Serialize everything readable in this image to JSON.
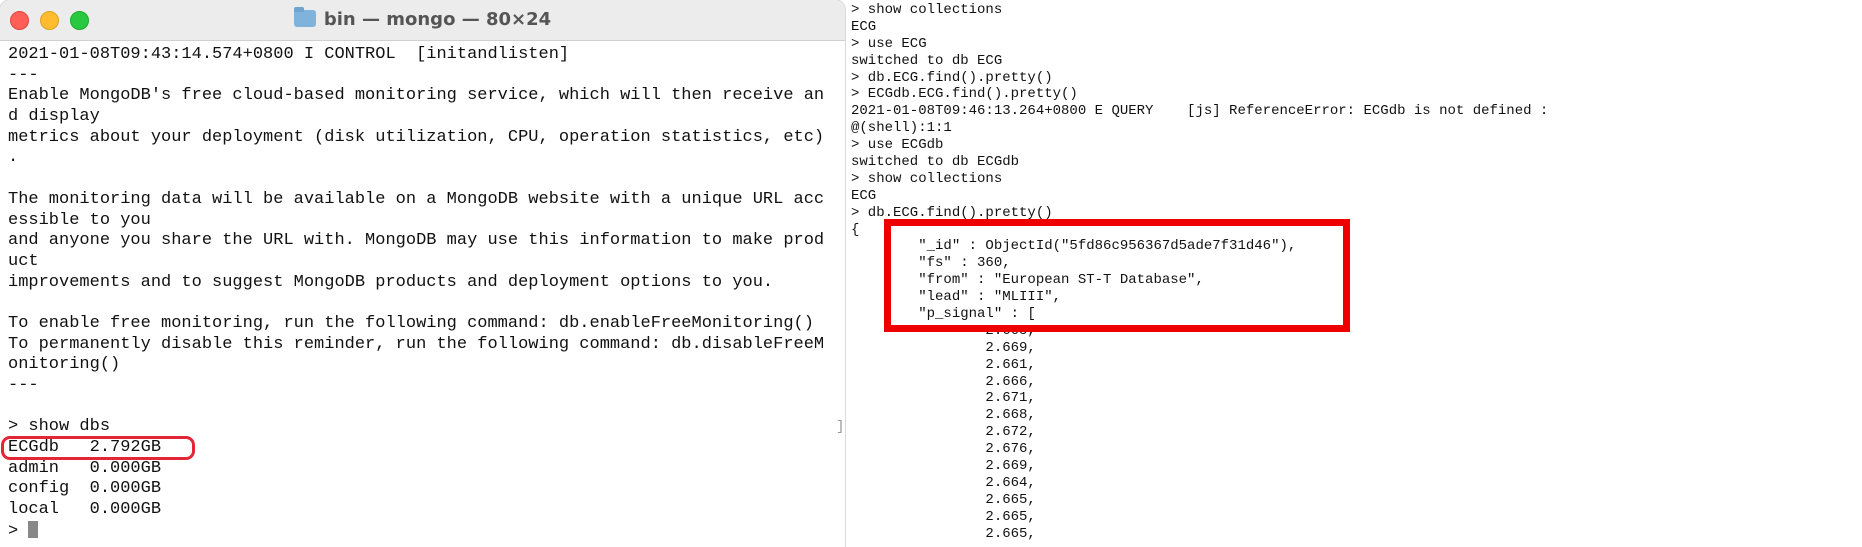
{
  "window": {
    "title": "bin — mongo — 80×24",
    "close_label": "×",
    "minimize_label": "−",
    "zoom_label": "+"
  },
  "left_terminal": {
    "lines": [
      "2021-01-08T09:43:14.574+0800 I CONTROL  [initandlisten]",
      "---",
      "Enable MongoDB's free cloud-based monitoring service, which will then receive an",
      "d display",
      "metrics about your deployment (disk utilization, CPU, operation statistics, etc)",
      ".",
      "",
      "The monitoring data will be available on a MongoDB website with a unique URL acc",
      "essible to you",
      "and anyone you share the URL with. MongoDB may use this information to make prod",
      "uct",
      "improvements and to suggest MongoDB products and deployment options to you.",
      "",
      "To enable free monitoring, run the following command: db.enableFreeMonitoring()",
      "To permanently disable this reminder, run the following command: db.disableFreeM",
      "onitoring()",
      "---",
      "",
      "> show dbs",
      "ECGdb   2.792GB",
      "admin   0.000GB",
      "config  0.000GB",
      "local   0.000GB"
    ],
    "prompt": "> ",
    "scroll_marker": "]"
  },
  "right_terminal": {
    "lines": [
      "> show collections",
      "ECG",
      "> use ECG",
      "switched to db ECG",
      "> db.ECG.find().pretty()",
      "> ECGdb.ECG.find().pretty()",
      "2021-01-08T09:46:13.264+0800 E QUERY    [js] ReferenceError: ECGdb is not defined :",
      "@(shell):1:1",
      "> use ECGdb",
      "switched to db ECGdb",
      "> show collections",
      "ECG",
      "> db.ECG.find().pretty()",
      "{",
      "        \"_id\" : ObjectId(\"5fd86c956367d5ade7f31d46\"),",
      "        \"fs\" : 360,",
      "        \"from\" : \"European ST-T Database\",",
      "        \"lead\" : \"MLIII\",",
      "        \"p_signal\" : [",
      "                2.665,",
      "                2.669,",
      "                2.661,",
      "                2.666,",
      "                2.671,",
      "                2.668,",
      "                2.672,",
      "                2.676,",
      "                2.669,",
      "                2.664,",
      "                2.665,",
      "                2.665,",
      "                2.665,"
    ]
  },
  "colors": {
    "highlight_red": "#e32636",
    "doc_box_red": "#ef0000"
  }
}
